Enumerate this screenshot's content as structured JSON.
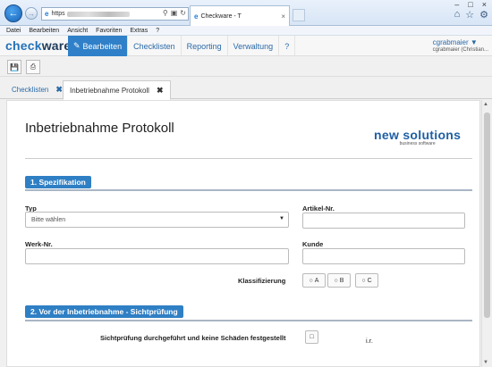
{
  "browser": {
    "url_prefix": "https",
    "tab_title": "Checkware - T",
    "menu": [
      "Datei",
      "Bearbeiten",
      "Ansicht",
      "Favoriten",
      "Extras",
      "?"
    ]
  },
  "app": {
    "logo_a": "check",
    "logo_b": "ware",
    "nav": [
      {
        "label": "Bearbeiten",
        "active": true
      },
      {
        "label": "Checklisten"
      },
      {
        "label": "Reporting"
      },
      {
        "label": "Verwaltung"
      },
      {
        "label": "?"
      }
    ],
    "user_name": "cgrabmaier",
    "user_sub": "cgrabmaier (Christian..."
  },
  "doc_tabs": [
    {
      "label": "Checklisten"
    },
    {
      "label": "Inbetriebnahme Protokoll"
    }
  ],
  "form": {
    "title": "Inbetriebnahme Protokoll",
    "brand_main": "new solutions",
    "brand_sub": "business software",
    "section1": "1. Spezifikation",
    "section2": "2. Vor der Inbetriebnahme - Sichtprüfung",
    "typ_label": "Typ",
    "typ_value": "Bitte wählen",
    "artikel_label": "Artikel-Nr.",
    "werk_label": "Werk-Nr.",
    "kunde_label": "Kunde",
    "klass_label": "Klassifizierung",
    "klass_options": [
      "A",
      "B",
      "C"
    ],
    "sicht_label": "Sichtprüfung durchgeführt und keine Schäden festgestellt",
    "io_label": "i.r."
  }
}
